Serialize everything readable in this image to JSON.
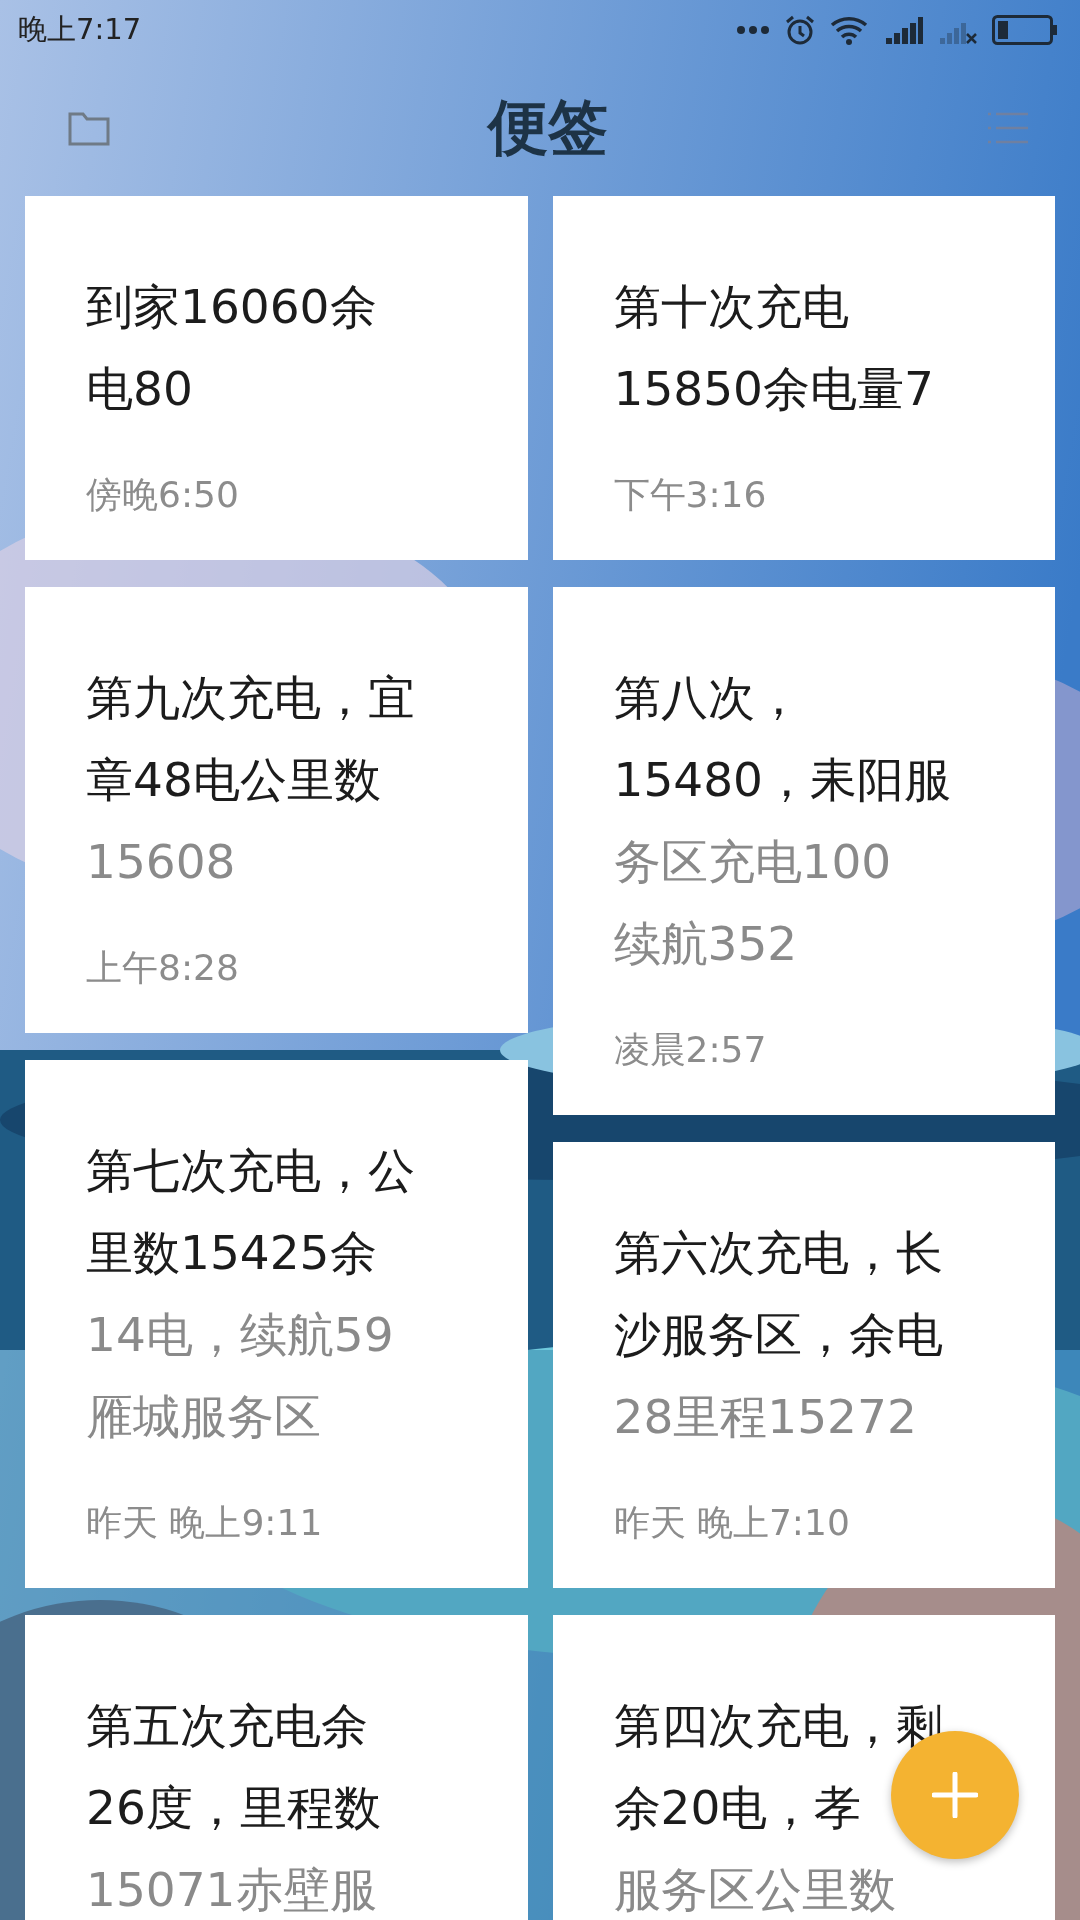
{
  "status_bar": {
    "time": "晚上7:17"
  },
  "header": {
    "title": "便签"
  },
  "notes": [
    {
      "title_lines": [
        "到家16060余",
        "电80"
      ],
      "time": "傍晚6:50"
    },
    {
      "title_lines": [
        "第十次充电",
        "15850余电量7"
      ],
      "time": "下午3:16"
    },
    {
      "title_lines": [
        "第九次充电，宜",
        "章48电公里数"
      ],
      "body_lines": [
        "15608"
      ],
      "time": "上午8:28"
    },
    {
      "title_lines": [
        "第八次，",
        "15480，耒阳服"
      ],
      "body_lines": [
        "务区充电100",
        "续航352"
      ],
      "time": "凌晨2:57"
    },
    {
      "title_lines": [
        "第七次充电，公",
        "里数15425余"
      ],
      "body_lines": [
        "14电，续航59",
        "雁城服务区"
      ],
      "time": "昨天 晚上9:11"
    },
    {
      "title_lines": [
        "第六次充电，长",
        "沙服务区，余电"
      ],
      "body_lines": [
        "28里程15272"
      ],
      "time": "昨天 晚上7:10"
    },
    {
      "title_lines": [
        "第五次充电余",
        "26度，里程数"
      ],
      "body_lines": [
        "15071赤壁服"
      ]
    },
    {
      "title_lines": [
        "第四次充电，剩",
        "余20电，孝"
      ],
      "body_lines": [
        "服务区公里数"
      ]
    }
  ]
}
